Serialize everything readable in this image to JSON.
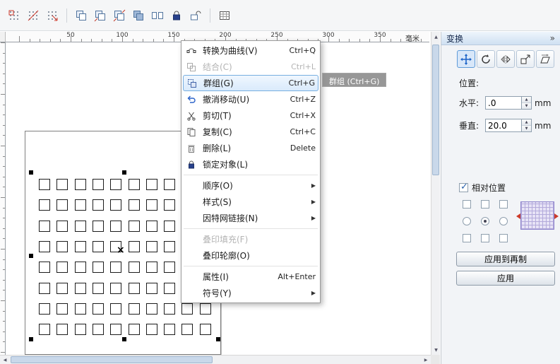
{
  "toolbar": {
    "icons": [
      {
        "name": "snap-to-grid"
      },
      {
        "name": "snap-to-guidelines"
      },
      {
        "name": "snap-to-objects"
      },
      {
        "name": "separator"
      },
      {
        "name": "group"
      },
      {
        "name": "ungroup"
      },
      {
        "name": "ungroup-all"
      },
      {
        "name": "combine"
      },
      {
        "name": "break-apart"
      },
      {
        "name": "lock-object"
      },
      {
        "name": "unlock-object"
      },
      {
        "name": "separator"
      },
      {
        "name": "table-tool"
      }
    ]
  },
  "ruler": {
    "unit_label": "毫米",
    "numbers": [
      50,
      100,
      150,
      200,
      250,
      300,
      350
    ]
  },
  "canvas": {
    "grid_rows": 8,
    "grid_cols": 10
  },
  "context_menu": {
    "items": [
      {
        "label": "转换为曲线(V)",
        "shortcut": "Ctrl+Q",
        "icon": "convert-to-curves"
      },
      {
        "label": "结合(C)",
        "shortcut": "Ctrl+L",
        "icon": "combine",
        "state": "disabled"
      },
      {
        "label": "群组(G)",
        "shortcut": "Ctrl+G",
        "icon": "group",
        "state": "highlighted"
      },
      {
        "label": "撤消移动(U)",
        "shortcut": "Ctrl+Z",
        "icon": "undo"
      },
      {
        "label": "剪切(T)",
        "shortcut": "Ctrl+X",
        "icon": "cut"
      },
      {
        "label": "复制(C)",
        "shortcut": "Ctrl+C",
        "icon": "copy"
      },
      {
        "label": "删除(L)",
        "shortcut": "Delete",
        "icon": "delete"
      },
      {
        "label": "锁定对象(L)",
        "icon": "lock",
        "separator_after": true
      },
      {
        "label": "顺序(O)",
        "submenu": true
      },
      {
        "label": "样式(S)",
        "submenu": true
      },
      {
        "label": "因特网链接(N)",
        "submenu": true,
        "separator_after": true
      },
      {
        "label": "叠印填充(F)",
        "state": "disabled"
      },
      {
        "label": "叠印轮廓(O)",
        "separator_after": true
      },
      {
        "label": "属性(I)",
        "shortcut": "Alt+Enter"
      },
      {
        "label": "符号(Y)",
        "submenu": true
      }
    ]
  },
  "tooltip": {
    "text": "群组 (Ctrl+G)"
  },
  "docker": {
    "title": "变换",
    "collapse_glyph": "»",
    "tools": [
      {
        "name": "position",
        "active": true
      },
      {
        "name": "rotate",
        "active": false
      },
      {
        "name": "scale-mirror",
        "active": false
      },
      {
        "name": "size",
        "active": false
      },
      {
        "name": "skew",
        "active": false
      }
    ],
    "position_label": "位置:",
    "fields": [
      {
        "label": "水平:",
        "value": ".0",
        "unit": "mm"
      },
      {
        "label": "垂直:",
        "value": "20.0",
        "unit": "mm"
      }
    ],
    "relative_position": {
      "label": "相对位置",
      "checked": true
    },
    "anchor_grid": [
      [
        "square",
        "square",
        "square"
      ],
      [
        "circle",
        "circle-dot",
        "circle"
      ],
      [
        "square",
        "square",
        "square"
      ]
    ],
    "buttons": [
      {
        "label": "应用到再制"
      },
      {
        "label": "应用"
      }
    ]
  }
}
